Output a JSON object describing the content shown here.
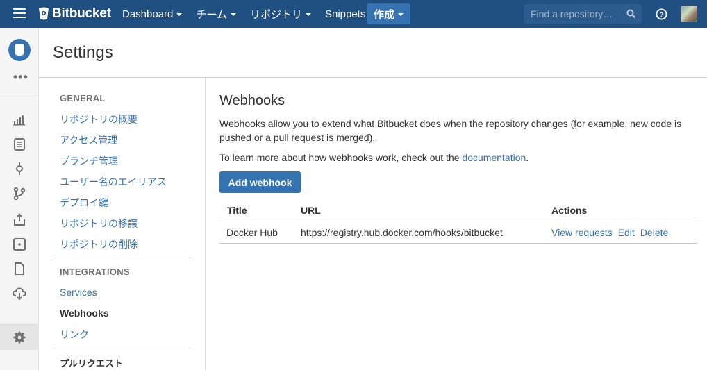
{
  "topbar": {
    "brand": "Bitbucket",
    "nav": [
      "Dashboard",
      "チーム",
      "リポジトリ",
      "Snippets"
    ],
    "create_label": "作成",
    "search_placeholder": "Find a repository…",
    "colors": {
      "bar": "#205081",
      "accent": "#3572b0"
    }
  },
  "sidebar": {
    "icons": [
      "repo-avatar",
      "more-icon",
      "overview-icon",
      "source-icon",
      "commits-icon",
      "branches-icon",
      "pull-requests-icon",
      "pipelines-icon",
      "downloads-icon",
      "deployments-icon",
      "settings-icon"
    ]
  },
  "page": {
    "title": "Settings"
  },
  "settings_nav": {
    "general_heading": "GENERAL",
    "general_items": [
      "リポジトリの概要",
      "アクセス管理",
      "ブランチ管理",
      "ユーザー名のエイリアス",
      "デプロイ鍵",
      "リポジトリの移譲",
      "リポジトリの削除"
    ],
    "integrations_heading": "INTEGRATIONS",
    "integrations_items": [
      "Services",
      "Webhooks",
      "リンク"
    ],
    "active": "Webhooks",
    "next_heading": "プルリクエスト"
  },
  "content": {
    "title": "Webhooks",
    "description": "Webhooks allow you to extend what Bitbucket does when the repository changes (for example, new code is pushed or a pull request is merged).",
    "learn_prefix": "To learn more about how webhooks work, check out the ",
    "learn_link": "documentation",
    "learn_suffix": ".",
    "add_button": "Add webhook",
    "table": {
      "headers": [
        "Title",
        "URL",
        "Actions"
      ],
      "rows": [
        {
          "title": "Docker Hub",
          "url": "https://registry.hub.docker.com/hooks/bitbucket",
          "actions": [
            "View requests",
            "Edit",
            "Delete"
          ]
        }
      ]
    }
  }
}
